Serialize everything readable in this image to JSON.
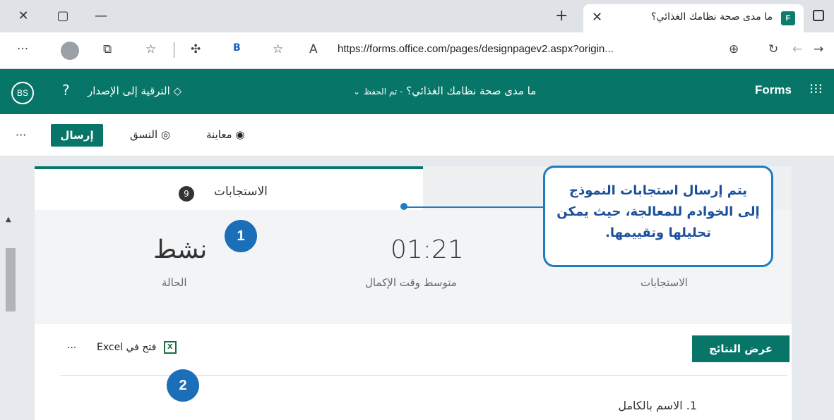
{
  "browser": {
    "tab_title": "ما مدى صحة نظامك الغذائي؟",
    "tab_favicon_text": "F",
    "url": "https://forms.office.com/pages/designpagev2.aspx?origin...",
    "extension_label": "B"
  },
  "forms_header": {
    "brand": "Forms",
    "form_title": "ما مدى صحة نظامك الغذائي؟",
    "saved_status": "- تم الحفظ",
    "upgrade": "الترقية إلى الإصدار",
    "help": "?",
    "user_initials": "BS"
  },
  "command_bar": {
    "send": "إرسال",
    "theme": "النسق",
    "preview": "معاينة",
    "more": "···"
  },
  "responses_tab": {
    "label": "الاستجابات",
    "count": "9"
  },
  "stats": {
    "status_value": "نشط",
    "status_label": "الحالة",
    "avg_time_value": "01:21",
    "avg_time_label": "متوسط وقت الإكمال",
    "responses_label": "الاستجابات"
  },
  "actions": {
    "view_results": "عرض النتائج",
    "open_excel": "فتح في Excel",
    "more": "···"
  },
  "questions": [
    {
      "label": "1.  الاسم بالكامل"
    }
  ],
  "callout": {
    "text": "يتم إرسال استجابات النموذج إلى الخوادم للمعالجة، حيث يمكن تحليلها وتقييمها."
  },
  "steps": [
    "1",
    "2"
  ],
  "colors": {
    "forms_teal": "#077568",
    "callout_blue": "#1b7ec2"
  }
}
